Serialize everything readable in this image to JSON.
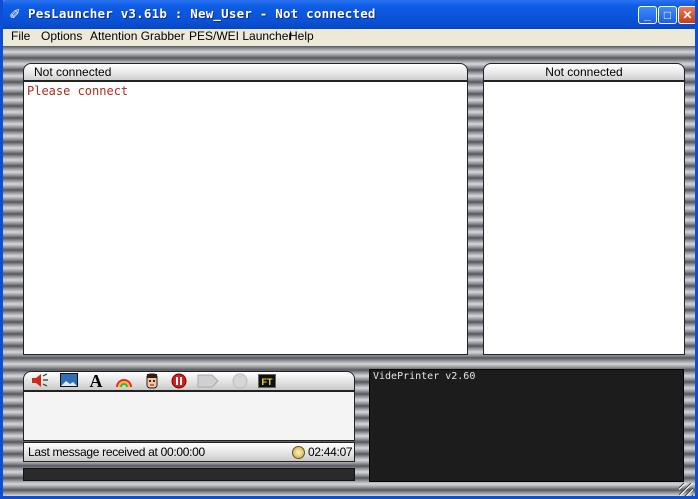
{
  "window": {
    "title": "PesLauncher v3.61b : New_User - Not connected",
    "controls": {
      "minimize": "_",
      "maximize": "□",
      "close": "✕"
    }
  },
  "menubar": {
    "items": [
      "File",
      "Options",
      "Attention Grabber",
      "PES/WEI Launcher",
      "Help"
    ]
  },
  "chat_panel": {
    "header": "Not connected",
    "message": "Please connect",
    "message_color": "#b22a1c"
  },
  "users_panel": {
    "header": "Not connected"
  },
  "toolbar": {
    "icons": [
      "speaker-icon",
      "image-icon",
      "font-icon",
      "rainbow-icon",
      "face-icon",
      "stop-icon",
      "send-icon",
      "record-icon",
      "ft-icon"
    ],
    "ft_label": "FT",
    "font_label": "A"
  },
  "status": {
    "last_message": "Last message received at 00:00:00",
    "clock": "02:44:07"
  },
  "videprinter": {
    "text": "VidePrinter v2.60"
  },
  "colors": {
    "titlebar": "#0a52d8",
    "menubar": "#ece9d8",
    "videprinter_bg": "#1c1c1c"
  }
}
